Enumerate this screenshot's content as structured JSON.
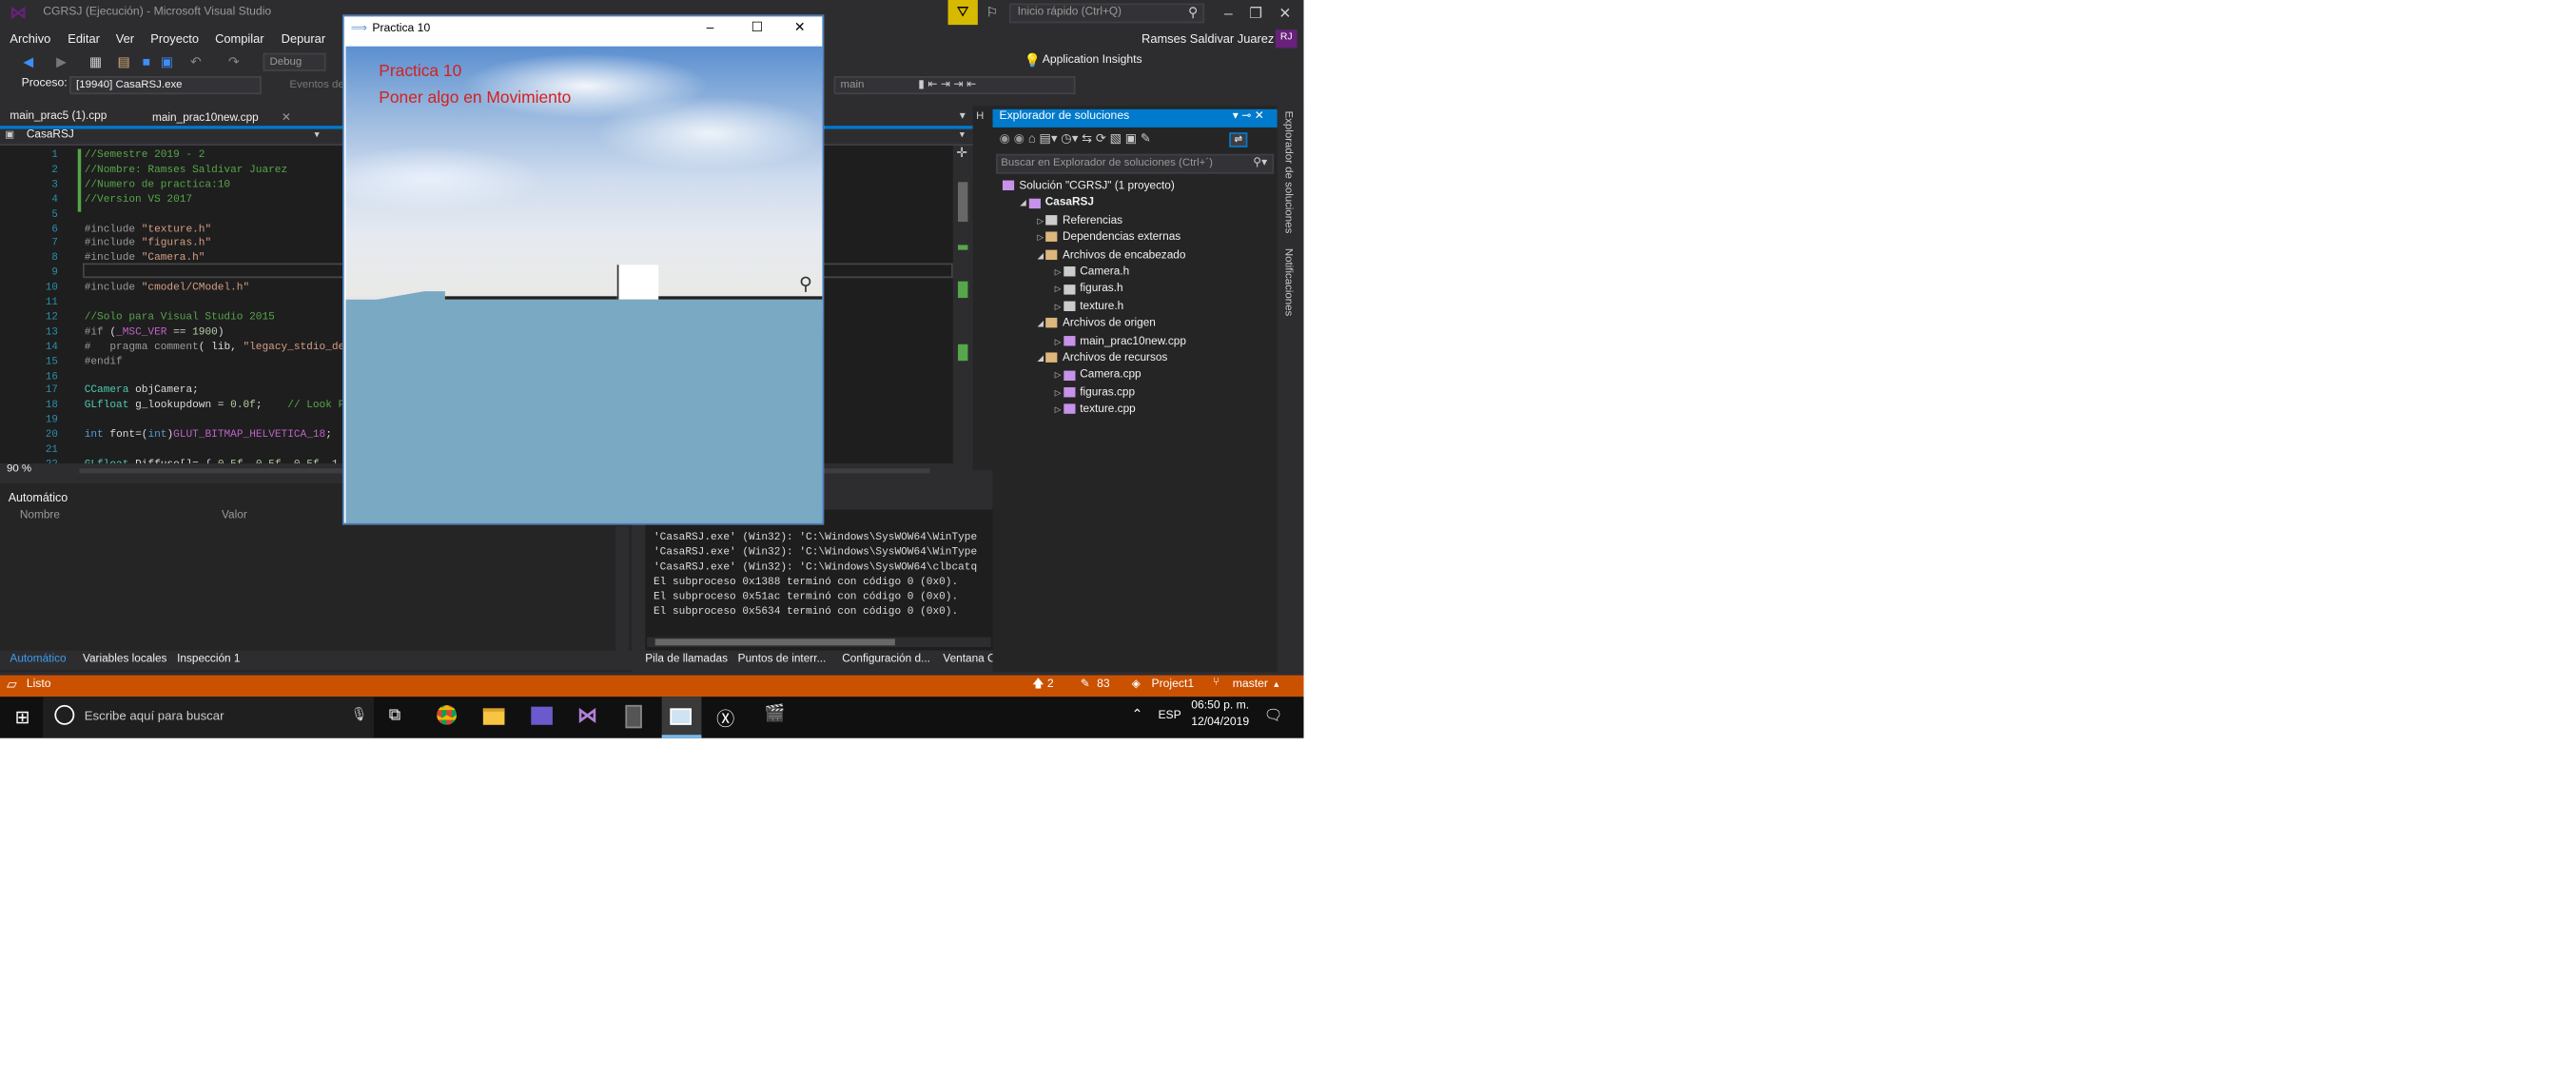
{
  "window": {
    "title": "CGRSJ (Ejecución) - Microsoft Visual Studio",
    "quick_launch_placeholder": "Inicio rápido (Ctrl+Q)",
    "user": "Ramses Saldivar Juarez",
    "user_initials": "RJ"
  },
  "menu": [
    "Archivo",
    "Editar",
    "Ver",
    "Proyecto",
    "Compilar",
    "Depurar"
  ],
  "toolbar": {
    "config": "Debug",
    "application_insights": "Application Insights"
  },
  "process": {
    "label": "Proceso:",
    "value": "[19940] CasaRSJ.exe",
    "events": "Eventos de",
    "frame": "main"
  },
  "tabs": [
    "main_prac5 (1).cpp",
    "main_prac10new.cpp"
  ],
  "editor": {
    "scope": "CasaRSJ",
    "zoom": "90 %",
    "lines": [
      {
        "n": "1",
        "html": "<span class=\"c-g\">//Semestre 2019 - 2</span>"
      },
      {
        "n": "2",
        "html": "<span class=\"c-g\">//Nombre: Ramses Saldivar Juarez</span>"
      },
      {
        "n": "3",
        "html": "<span class=\"c-g\">//Numero de practica:10</span>"
      },
      {
        "n": "4",
        "html": "<span class=\"c-g\">//Version VS 2017</span>"
      },
      {
        "n": "5",
        "html": ""
      },
      {
        "n": "6",
        "html": "<span class=\"c-p\">#include</span> <span class=\"c-s\">\"texture.h\"</span>"
      },
      {
        "n": "7",
        "html": "<span class=\"c-p\">#include</span> <span class=\"c-s\">\"figuras.h\"</span>"
      },
      {
        "n": "8",
        "html": "<span class=\"c-p\">#include</span> <span class=\"c-s\">\"Camera.h\"</span>"
      },
      {
        "n": "9",
        "html": ""
      },
      {
        "n": "10",
        "html": "<span class=\"c-p\">#include</span> <span class=\"c-s\">\"cmodel/CModel.h\"</span>"
      },
      {
        "n": "11",
        "html": ""
      },
      {
        "n": "12",
        "html": "<span class=\"c-g\">//Solo para Visual Studio 2015</span>"
      },
      {
        "n": "13",
        "html": "<span class=\"c-p\">#if</span> (<span class=\"c-m\">_MSC_VER</span> == <span class=\"c-n\">1900</span>)"
      },
      {
        "n": "14",
        "html": "<span class=\"c-p\">#   pragma comment</span>( lib, <span class=\"c-s\">\"legacy_stdio_def</span>"
      },
      {
        "n": "15",
        "html": "<span class=\"c-p\">#endif</span>"
      },
      {
        "n": "16",
        "html": ""
      },
      {
        "n": "17",
        "html": "<span class=\"c-t\">CCamera</span> objCamera;"
      },
      {
        "n": "18",
        "html": "<span class=\"c-t\">GLfloat</span> g_lookupdown = <span class=\"c-n\">0.0f</span>;    <span class=\"c-g\">// Look Po</span>"
      },
      {
        "n": "19",
        "html": ""
      },
      {
        "n": "20",
        "html": "<span class=\"c-b\">int</span> font=(<span class=\"c-b\">int</span>)<span class=\"c-m\">GLUT_BITMAP_HELVETICA_18</span>;"
      },
      {
        "n": "21",
        "html": ""
      },
      {
        "n": "22",
        "html": "<span class=\"c-t\">GLfloat</span> Diffuse[]= { <span class=\"c-n\">0.5f</span>, <span class=\"c-n\">0.5f</span>, <span class=\"c-n\">0.5f</span>, <span class=\"c-n\">1.0</span>"
      }
    ]
  },
  "autos": {
    "title": "Automático",
    "col_name": "Nombre",
    "col_value": "Valor",
    "tabs": [
      "Automático",
      "Variables locales",
      "Inspección 1"
    ]
  },
  "output": {
    "lines": [
      "'CasaRSJ.exe' (Win32): 'C:\\Windows\\SysWOW64\\WinType",
      "'CasaRSJ.exe' (Win32): 'C:\\Windows\\SysWOW64\\WinType",
      "'CasaRSJ.exe' (Win32): 'C:\\Windows\\SysWOW64\\clbcatq",
      "El subproceso 0x1388 terminó con código 0 (0x0).",
      "El subproceso 0x51ac terminó con código 0 (0x0).",
      "El subproceso 0x5634 terminó con código 0 (0x0)."
    ],
    "tabs": [
      "Pila de llamadas",
      "Puntos de interr...",
      "Configuración d...",
      "Ventana C"
    ]
  },
  "solution_explorer": {
    "title": "Explorador de soluciones",
    "search_placeholder": "Buscar en Explorador de soluciones (Ctrl+´)",
    "side_tabs": [
      "Explorador de soluciones",
      "Notificaciones"
    ],
    "items": [
      {
        "label": "Solución \"CGRSJ\" (1 proyecto)",
        "indent": 0,
        "kind": "solution"
      },
      {
        "label": "CasaRSJ",
        "indent": 1,
        "kind": "project"
      },
      {
        "label": "Referencias",
        "indent": 2,
        "kind": "ref"
      },
      {
        "label": "Dependencias externas",
        "indent": 2,
        "kind": "folder"
      },
      {
        "label": "Archivos de encabezado",
        "indent": 2,
        "kind": "folder"
      },
      {
        "label": "Camera.h",
        "indent": 3,
        "kind": "h"
      },
      {
        "label": "figuras.h",
        "indent": 3,
        "kind": "h"
      },
      {
        "label": "texture.h",
        "indent": 3,
        "kind": "h"
      },
      {
        "label": "Archivos de origen",
        "indent": 2,
        "kind": "folder"
      },
      {
        "label": "main_prac10new.cpp",
        "indent": 3,
        "kind": "cpp"
      },
      {
        "label": "Archivos de recursos",
        "indent": 2,
        "kind": "folder"
      },
      {
        "label": "Camera.cpp",
        "indent": 3,
        "kind": "cpp"
      },
      {
        "label": "figuras.cpp",
        "indent": 3,
        "kind": "cpp"
      },
      {
        "label": "texture.cpp",
        "indent": 3,
        "kind": "cpp"
      }
    ]
  },
  "statusbar": {
    "text": "Listo",
    "up": "2",
    "edits": "83",
    "project": "Project1",
    "branch": "master"
  },
  "glwindow": {
    "title": "Practica 10",
    "line1": "Practica 10",
    "line2": "Poner algo en Movimiento"
  },
  "taskbar": {
    "search_placeholder": "Escribe aquí para buscar",
    "lang": "ESP",
    "time": "06:50 p. m.",
    "date": "12/04/2019"
  },
  "colors": {
    "accent": "#007acc",
    "status": "#ca5100",
    "gl_text": "#d42020",
    "vs_purple": "#68217a"
  }
}
